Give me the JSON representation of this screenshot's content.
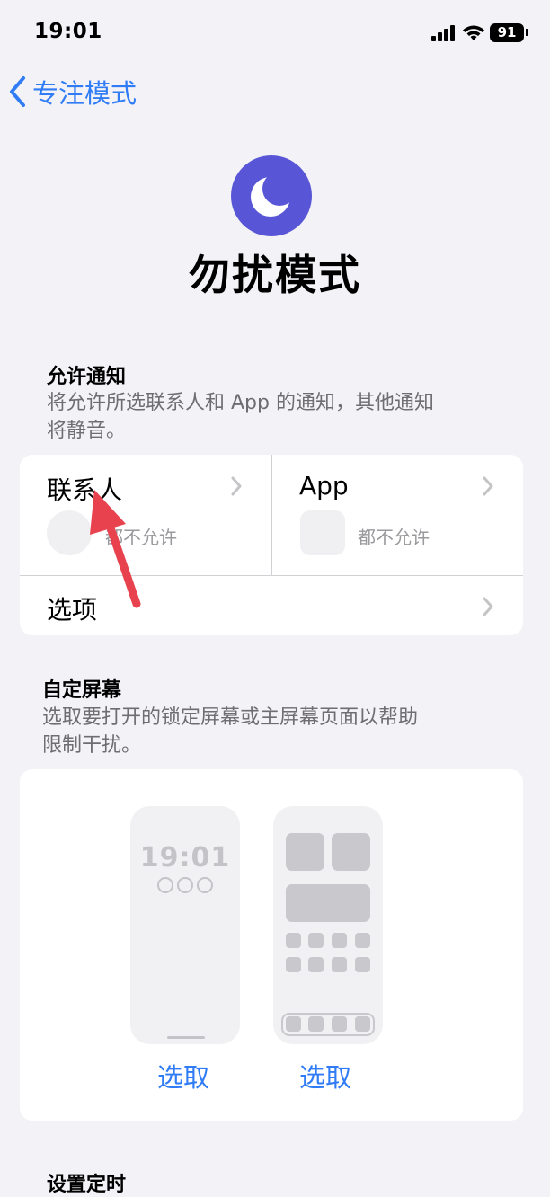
{
  "status_bar": {
    "time": "19:01",
    "battery": "91"
  },
  "nav": {
    "back_label": "专注模式"
  },
  "header": {
    "title": "勿扰模式"
  },
  "allow_notifications": {
    "title": "允许通知",
    "desc_line1": "将允许所选联系人和 App 的通知，其他通知",
    "desc_line2": "将静音。",
    "contacts_label": "联系人",
    "contacts_status": "都不允许",
    "apps_label": "App",
    "apps_status": "都不允许",
    "options_label": "选项"
  },
  "customize_screens": {
    "title": "自定屏幕",
    "desc_line1": "选取要打开的锁定屏幕或主屏幕页面以帮助",
    "desc_line2": "限制干扰。",
    "lock_preview_time": "19:01",
    "choose_lock_label": "选取",
    "choose_home_label": "选取"
  },
  "schedule": {
    "title": "设置定时"
  },
  "colors": {
    "accent": "#2f7cf6",
    "moon_bg": "#5856d6",
    "arrow": "#e8424f"
  }
}
